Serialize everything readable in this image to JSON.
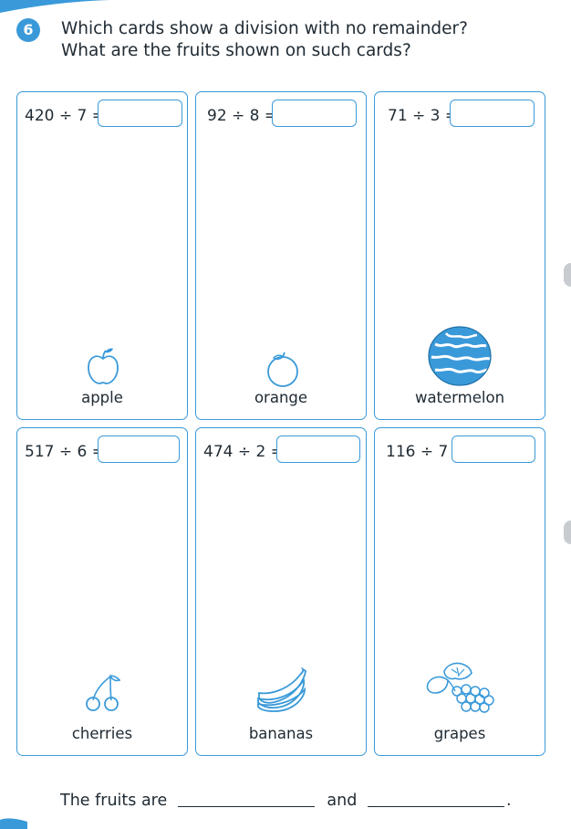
{
  "question": {
    "number": "6",
    "line1": "Which cards show a division with no remainder?",
    "line2": "What are the fruits shown on such cards?"
  },
  "cards": [
    {
      "equation": "420 ÷ 7 =",
      "fruit": "apple",
      "icon": "apple-icon"
    },
    {
      "equation": "92 ÷ 8 =",
      "fruit": "orange",
      "icon": "orange-icon"
    },
    {
      "equation": "71 ÷ 3 =",
      "fruit": "watermelon",
      "icon": "watermelon-icon"
    },
    {
      "equation": "517 ÷ 6 =",
      "fruit": "cherries",
      "icon": "cherries-icon"
    },
    {
      "equation": "474 ÷ 2 =",
      "fruit": "bananas",
      "icon": "bananas-icon"
    },
    {
      "equation": "116 ÷ 7 =",
      "fruit": "grapes",
      "icon": "grapes-icon"
    }
  ],
  "footer": {
    "prefix": "The fruits are",
    "middle": "and",
    "suffix": "."
  },
  "colors": {
    "accent": "#3a9ad9",
    "text": "#1f2a33"
  }
}
